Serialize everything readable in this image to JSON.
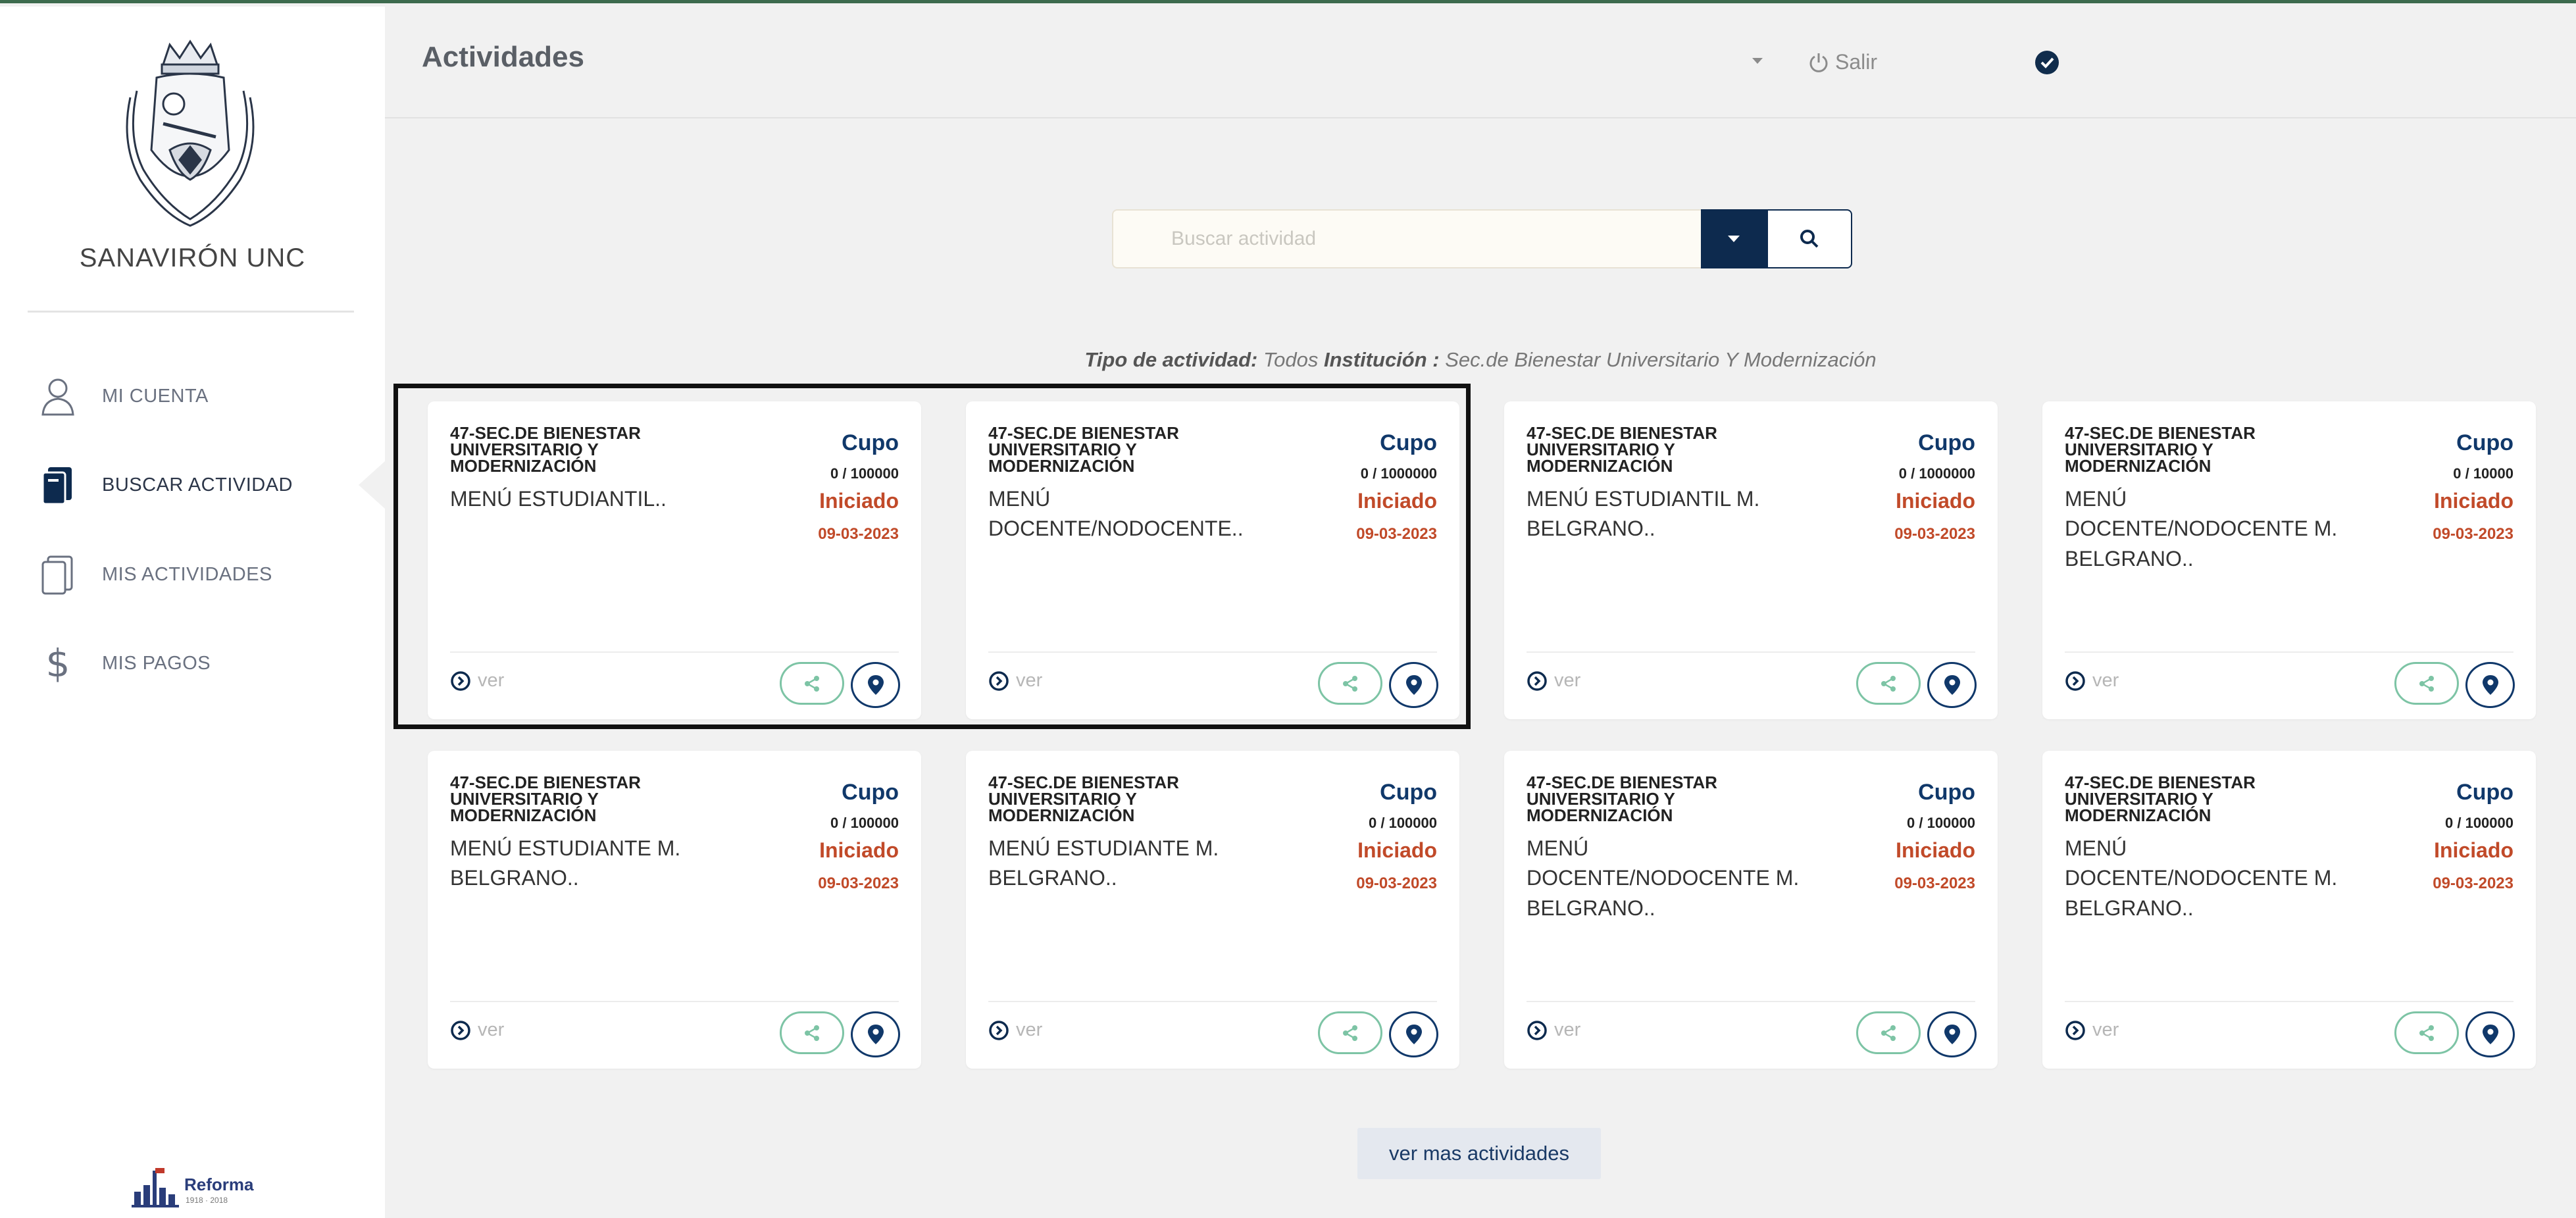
{
  "sidebar": {
    "brand": "SANAVIRÓN UNC",
    "items": [
      {
        "label": "MI CUENTA",
        "icon": "user-icon"
      },
      {
        "label": "BUSCAR ACTIVIDAD",
        "icon": "document-search-icon"
      },
      {
        "label": "MIS ACTIVIDADES",
        "icon": "documents-icon"
      },
      {
        "label": "MIS PAGOS",
        "icon": "dollar-icon"
      }
    ],
    "footer_logo": "Reforma",
    "footer_logo_sub": "1918 · 2018"
  },
  "header": {
    "title": "Actividades",
    "logout_label": "Salir"
  },
  "search": {
    "placeholder": "Buscar actividad"
  },
  "filter": {
    "type_label": "Tipo de actividad:",
    "type_value": "Todos",
    "institution_label": "Institución :",
    "institution_value": "Sec.de Bienestar Universitario Y Modernización"
  },
  "cards": [
    {
      "institution": "47-SEC.DE BIENESTAR UNIVERSITARIO Y MODERNIZACIÓN",
      "title": "MENÚ ESTUDIANTIL..",
      "cupo_label": "Cupo",
      "cupo": "0 / 100000",
      "status": "Iniciado",
      "date": "09-03-2023",
      "ver": "ver"
    },
    {
      "institution": "47-SEC.DE BIENESTAR UNIVERSITARIO Y MODERNIZACIÓN",
      "title": "MENÚ DOCENTE/NODOCENTE..",
      "cupo_label": "Cupo",
      "cupo": "0 / 1000000",
      "status": "Iniciado",
      "date": "09-03-2023",
      "ver": "ver"
    },
    {
      "institution": "47-SEC.DE BIENESTAR UNIVERSITARIO Y MODERNIZACIÓN",
      "title": "MENÚ ESTUDIANTIL M. BELGRANO..",
      "cupo_label": "Cupo",
      "cupo": "0 / 1000000",
      "status": "Iniciado",
      "date": "09-03-2023",
      "ver": "ver"
    },
    {
      "institution": "47-SEC.DE BIENESTAR UNIVERSITARIO Y MODERNIZACIÓN",
      "title": "MENÚ DOCENTE/NODOCENTE M. BELGRANO..",
      "cupo_label": "Cupo",
      "cupo": "0 / 10000",
      "status": "Iniciado",
      "date": "09-03-2023",
      "ver": "ver"
    },
    {
      "institution": "47-SEC.DE BIENESTAR UNIVERSITARIO Y MODERNIZACIÓN",
      "title": "MENÚ ESTUDIANTE M. BELGRANO..",
      "cupo_label": "Cupo",
      "cupo": "0 / 100000",
      "status": "Iniciado",
      "date": "09-03-2023",
      "ver": "ver"
    },
    {
      "institution": "47-SEC.DE BIENESTAR UNIVERSITARIO Y MODERNIZACIÓN",
      "title": "MENÚ ESTUDIANTE M. BELGRANO..",
      "cupo_label": "Cupo",
      "cupo": "0 / 100000",
      "status": "Iniciado",
      "date": "09-03-2023",
      "ver": "ver"
    },
    {
      "institution": "47-SEC.DE BIENESTAR UNIVERSITARIO Y MODERNIZACIÓN",
      "title": "MENÚ DOCENTE/NODOCENTE M. BELGRANO..",
      "cupo_label": "Cupo",
      "cupo": "0 / 100000",
      "status": "Iniciado",
      "date": "09-03-2023",
      "ver": "ver"
    },
    {
      "institution": "47-SEC.DE BIENESTAR UNIVERSITARIO Y MODERNIZACIÓN",
      "title": "MENÚ DOCENTE/NODOCENTE M. BELGRANO..",
      "cupo_label": "Cupo",
      "cupo": "0 / 100000",
      "status": "Iniciado",
      "date": "09-03-2023",
      "ver": "ver"
    }
  ],
  "more_button": "ver mas actividades",
  "colors": {
    "accent_navy": "#0d2a4e",
    "status_red": "#c14a29",
    "share_green": "#7dc4a5"
  }
}
